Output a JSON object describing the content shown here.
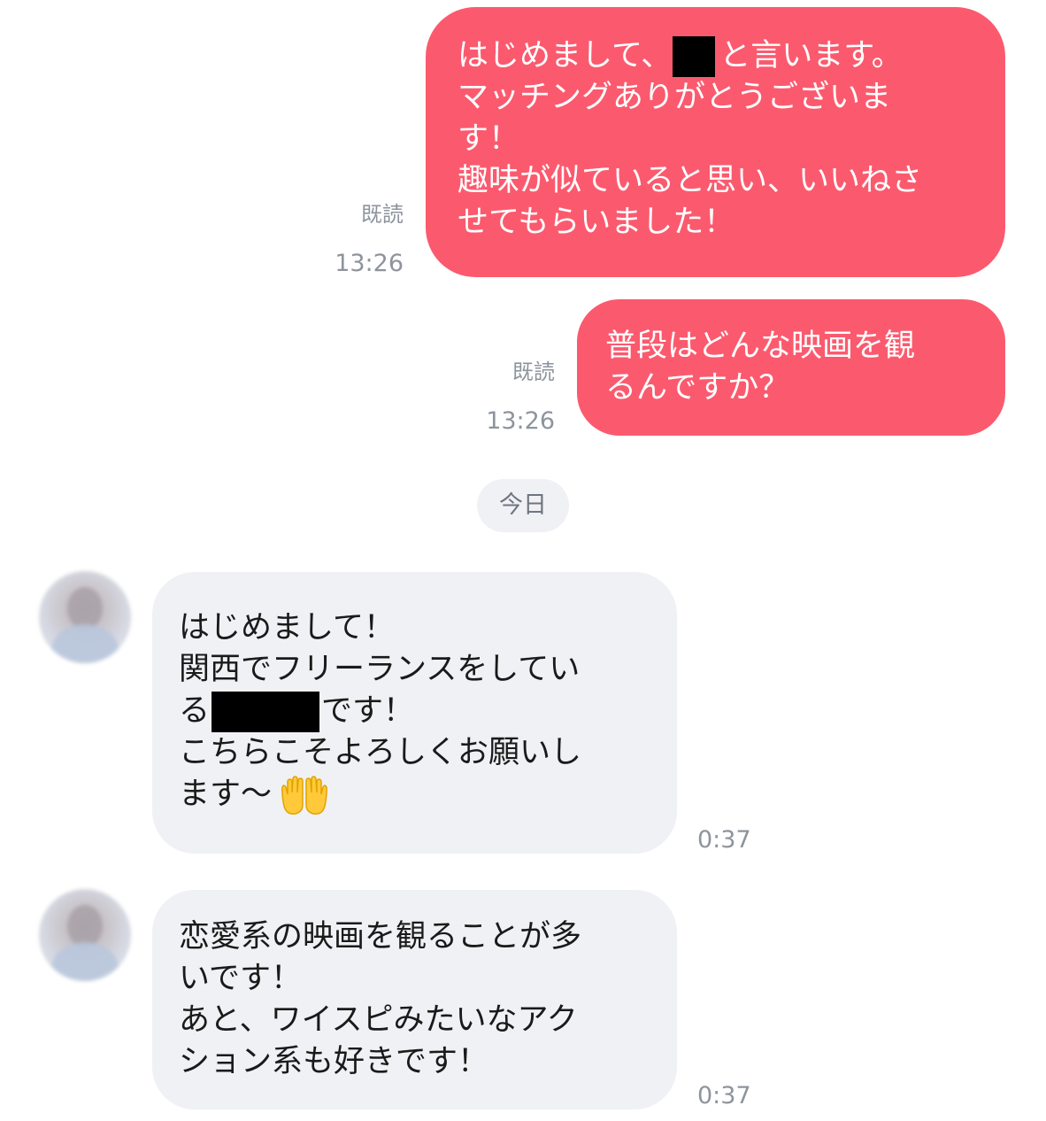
{
  "messages_out": [
    {
      "read": "既読",
      "time": "13:26",
      "lines": [
        {
          "pre": "はじめまして、",
          "redacted": true,
          "post": "と言います。"
        },
        {
          "text": "マッチングありがとうございま"
        },
        {
          "text": "す！"
        },
        {
          "text": "趣味が似ていると思い、いいねさ"
        },
        {
          "text": "せてもらいました！"
        }
      ]
    },
    {
      "read": "既読",
      "time": "13:26",
      "lines": [
        {
          "text": "普段はどんな映画を観"
        },
        {
          "text": "るんですか？"
        }
      ]
    }
  ],
  "date_divider": "今日",
  "messages_in": [
    {
      "time": "0:37",
      "lines": [
        {
          "text": "はじめまして！"
        },
        {
          "text": "関西でフリーランスをしてい"
        },
        {
          "pre": "る",
          "redacted": true,
          "post": "です！"
        },
        {
          "text": "こちらこそよろしくお願いし"
        },
        {
          "text": "ます〜",
          "emoji": "palms-up-together-emoji"
        }
      ]
    },
    {
      "time": "0:37",
      "lines": [
        {
          "text": "恋愛系の映画を観ることが多"
        },
        {
          "text": "いです！"
        },
        {
          "text": "あと、ワイスピみたいなアク"
        },
        {
          "text": "ション系も好きです！"
        }
      ]
    }
  ],
  "colors": {
    "outgoing_bubble": "#fb5a6e",
    "incoming_bubble": "#f0f1f4",
    "meta_text": "#8e949d"
  }
}
